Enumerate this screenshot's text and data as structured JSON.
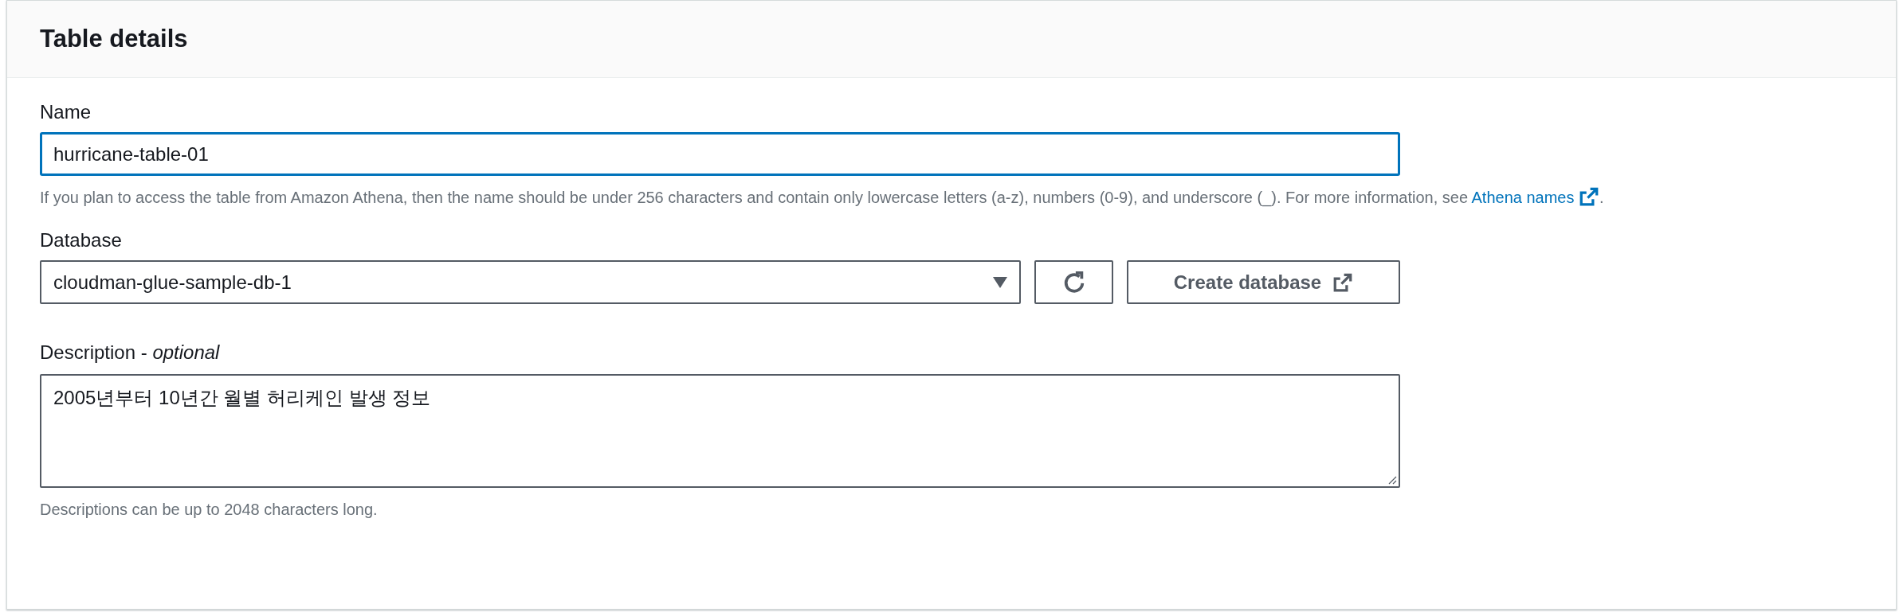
{
  "panel": {
    "title": "Table details"
  },
  "name_field": {
    "label": "Name",
    "value": "hurricane-table-01",
    "focused": true,
    "hint": {
      "text": "If you plan to access the table from Amazon Athena, then the name should be under 256 characters and contain only lowercase letters (a-z), numbers (0-9), and underscore (_). For more information, see",
      "link": "Athena names",
      "after": "."
    }
  },
  "database_field": {
    "label": "Database",
    "value": "cloudman-glue-sample-db-1",
    "create_button": "Create database"
  },
  "description_field": {
    "label": "Description - *optional*",
    "value": "2005년부터 10년간 월별 허리케인 발생 정보",
    "hint": "Descriptions can be up to 2048 characters long."
  }
}
